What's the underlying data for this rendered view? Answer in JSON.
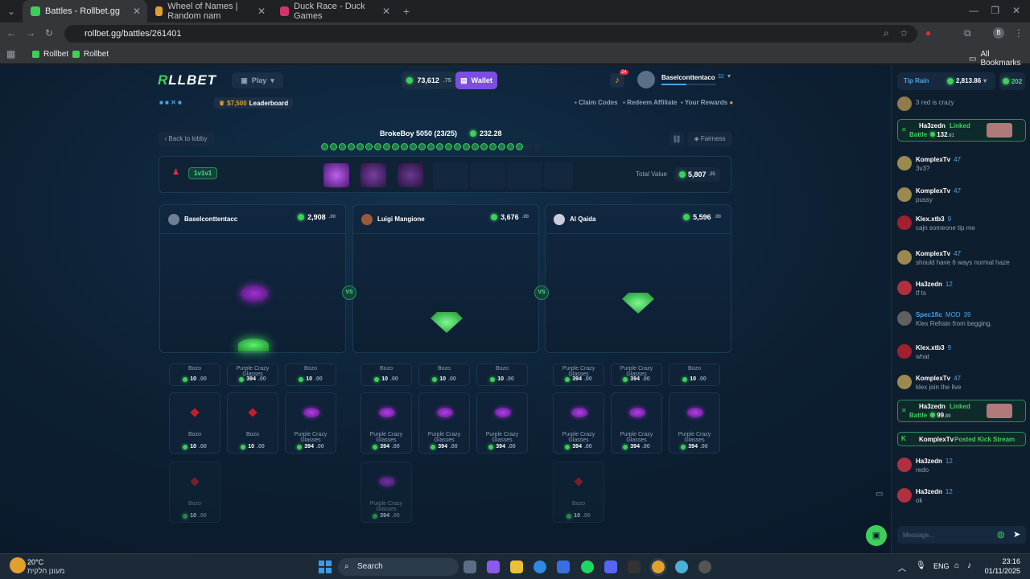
{
  "browser": {
    "tabs": [
      {
        "label": "Battles - Rollbet.gg",
        "active": true
      },
      {
        "label": "Wheel of Names | Random nam"
      },
      {
        "label": "Duck Race - Duck Games"
      }
    ],
    "new_tab": "+",
    "url": "rollbet.gg/battles/261401",
    "profile": "B",
    "bookmarks": [
      "Rollbet",
      "Rollbet"
    ],
    "all_bookmarks": "All Bookmarks"
  },
  "nav": {
    "logo_a": "R",
    "logo_b": "LLBET",
    "play": "Play",
    "balance": "73,612",
    "balance_cents": ".75",
    "wallet": "Wallet",
    "notif_count": "24",
    "username": "Baselconttentaco",
    "user_level": "32"
  },
  "subnav": {
    "leaderboard_amount": "$7,500",
    "leaderboard": "Leaderboard",
    "claim_codes": "Claim Codes",
    "redeem_affiliate": "Redeem Affiliate",
    "your_rewards": "Your Rewards"
  },
  "battle": {
    "back": "Back to lobby",
    "title": "BrokeBoy 5050 (23/25)",
    "title_value": "232.28",
    "fairness": "Fairness",
    "mode": "1v1v1",
    "total_value_label": "Total Value",
    "total_value": "5,807",
    "total_value_cents": ".25",
    "vs": "VS"
  },
  "players": [
    {
      "name": "Baselconttentacc",
      "value": "2,908",
      "cents": ".00"
    },
    {
      "name": "Luigi Mangione",
      "value": "3,676",
      "cents": ".00"
    },
    {
      "name": "Al Qaida",
      "value": "5,596",
      "cents": ".00"
    }
  ],
  "items": {
    "bozo": "Bozo",
    "bozo_price": "10",
    "bozo_cents": ".00",
    "glasses": "Purple Crazy Glasses",
    "glasses_price": "394",
    "glasses_cents": ".00"
  },
  "chat": {
    "tip_rain": "Tip Rain",
    "rain_amount": "2,813.86",
    "online": "202",
    "messages": [
      {
        "user": "",
        "level": "",
        "text": "3 red is crazy"
      },
      {
        "user": "KomplexTv",
        "level": "47",
        "text": "3v3?"
      },
      {
        "user": "KomplexTv",
        "level": "47",
        "text": "pussy"
      },
      {
        "user": "Klex.xtb3",
        "level": "9",
        "text": "cajn someone tip me"
      },
      {
        "user": "KomplexTv",
        "level": "47",
        "text": "should have 6 ways normal haze"
      },
      {
        "user": "Ha3zedn",
        "level": "12",
        "text": "tf ts"
      },
      {
        "user": "Spec1fic",
        "level": "39",
        "text": "Klex Refrain from begging.",
        "badge": "MOD"
      },
      {
        "user": "Klex.xtb3",
        "level": "9",
        "text": "what"
      },
      {
        "user": "KomplexTv",
        "level": "47",
        "text": "klex join the live"
      },
      {
        "user": "Ha3zedn",
        "level": "12",
        "text": "redo"
      },
      {
        "user": "Ha3zedn",
        "level": "12",
        "text": "ok"
      }
    ],
    "linked1": {
      "user": "Ha3zedn",
      "action": "Linked",
      "sub": "Battle",
      "amount": "132",
      "cents": ".81"
    },
    "linked2": {
      "user": "Ha3zedn",
      "action": "Linked",
      "sub": "Battle",
      "amount": "99",
      "cents": ".89"
    },
    "stream": {
      "user": "KomplexTv",
      "action": "Posted Kick Stream"
    },
    "placeholder": "Message..."
  },
  "taskbar": {
    "temp": "20°C",
    "weather": "מעונן חלקית",
    "search": "Search",
    "lang": "ENG",
    "time": "23:16",
    "date": "01/11/2025"
  }
}
